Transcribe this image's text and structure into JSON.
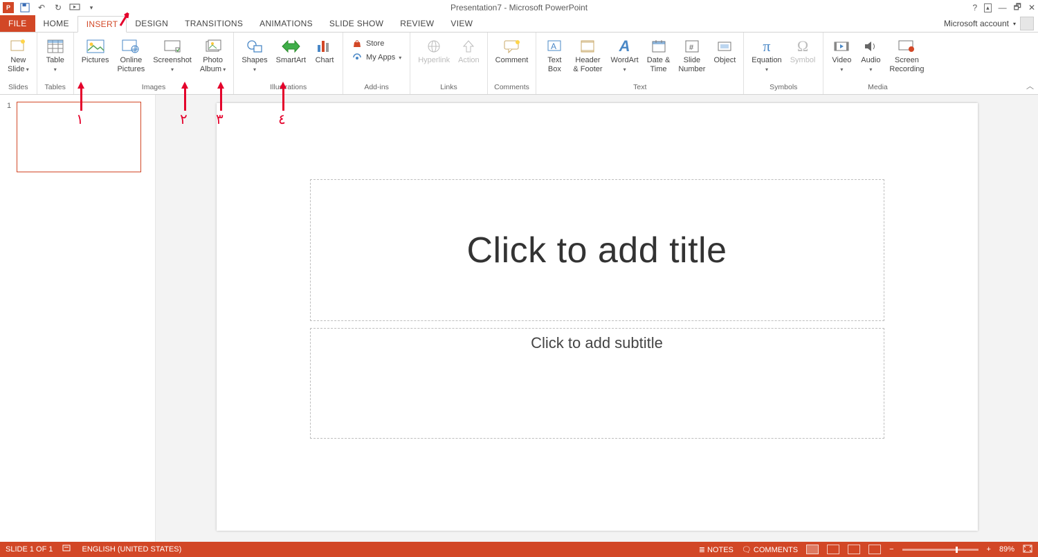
{
  "title": "Presentation7 - Microsoft PowerPoint",
  "account_label": "Microsoft account",
  "tabs": {
    "file": "FILE",
    "home": "HOME",
    "insert": "INSERT",
    "design": "DESIGN",
    "transitions": "TRANSITIONS",
    "animations": "ANIMATIONS",
    "slideshow": "SLIDE SHOW",
    "review": "REVIEW",
    "view": "VIEW"
  },
  "ribbon": {
    "slides": {
      "new_slide": "New\nSlide",
      "group": "Slides"
    },
    "tables": {
      "table": "Table",
      "group": "Tables"
    },
    "images": {
      "pictures": "Pictures",
      "online_pictures": "Online\nPictures",
      "screenshot": "Screenshot",
      "photo_album": "Photo\nAlbum",
      "group": "Images"
    },
    "illustrations": {
      "shapes": "Shapes",
      "smartart": "SmartArt",
      "chart": "Chart",
      "group": "Illustrations"
    },
    "addins": {
      "store": "Store",
      "my_apps": "My Apps",
      "group": "Add-ins"
    },
    "links": {
      "hyperlink": "Hyperlink",
      "action": "Action",
      "group": "Links"
    },
    "comments": {
      "comment": "Comment",
      "group": "Comments"
    },
    "text": {
      "text_box": "Text\nBox",
      "header_footer": "Header\n& Footer",
      "wordart": "WordArt",
      "date_time": "Date &\nTime",
      "slide_number": "Slide\nNumber",
      "object": "Object",
      "group": "Text"
    },
    "symbols": {
      "equation": "Equation",
      "symbol": "Symbol",
      "group": "Symbols"
    },
    "media": {
      "video": "Video",
      "audio": "Audio",
      "screen_recording": "Screen\nRecording",
      "group": "Media"
    }
  },
  "slide": {
    "thumb_number": "1",
    "title_placeholder": "Click to add title",
    "subtitle_placeholder": "Click to add subtitle"
  },
  "status": {
    "slide_of": "SLIDE 1 OF 1",
    "language": "ENGLISH (UNITED STATES)",
    "notes": "NOTES",
    "comments": "COMMENTS",
    "zoom": "89%"
  },
  "annotations": {
    "a1": "١",
    "a2": "٢",
    "a3": "٣",
    "a4": "٤"
  }
}
